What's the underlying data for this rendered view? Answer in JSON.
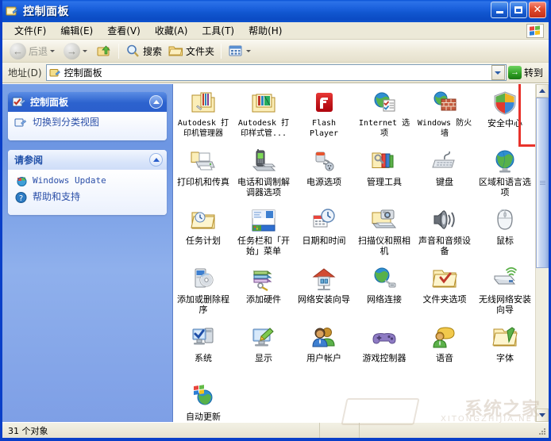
{
  "window": {
    "title": "控制面板",
    "title_icon": "control-panel-icon",
    "buttons": {
      "minimize": "–",
      "maximize": "□",
      "close": "✕"
    }
  },
  "menubar": {
    "items": [
      {
        "label": "文件(F)",
        "name": "menu-file"
      },
      {
        "label": "编辑(E)",
        "name": "menu-edit"
      },
      {
        "label": "查看(V)",
        "name": "menu-view"
      },
      {
        "label": "收藏(A)",
        "name": "menu-favorites"
      },
      {
        "label": "工具(T)",
        "name": "menu-tools"
      },
      {
        "label": "帮助(H)",
        "name": "menu-help"
      }
    ],
    "brand_icon": "windows-flag-icon"
  },
  "toolbar": {
    "back_label": "后退",
    "forward_label": "",
    "up_label": "",
    "search_label": "搜索",
    "folders_label": "文件夹",
    "views_label": ""
  },
  "addressbar": {
    "label": "地址(D)",
    "value": "控制面板",
    "go_label": "转到",
    "go_arrow": "→"
  },
  "sidebar": {
    "panels": [
      {
        "title": "控制面板",
        "icon": "control-panel-icon",
        "collapse_icon": "chevron-up-icon",
        "links": [
          {
            "label": "切换到分类视图",
            "icon": "switch-view-icon",
            "mono": false
          }
        ]
      },
      {
        "title": "请参阅",
        "icon": "",
        "collapse_icon": "chevron-up-icon",
        "links": [
          {
            "label": "Windows Update",
            "icon": "windows-update-icon",
            "mono": true
          },
          {
            "label": "帮助和支持",
            "icon": "help-support-icon",
            "mono": false
          }
        ]
      }
    ]
  },
  "content": {
    "highlighted_item": "Internet 选项",
    "highlight_color": "#E8322B",
    "items": [
      {
        "label": "Autodesk 打印机管理器",
        "icon": "autodesk-plotter-manager-icon",
        "mono": true
      },
      {
        "label": "Autodesk 打印样式管...",
        "icon": "autodesk-plot-style-icon",
        "mono": true
      },
      {
        "label": "Flash Player",
        "icon": "flash-player-icon",
        "mono": true
      },
      {
        "label": "Internet 选项",
        "icon": "internet-options-icon",
        "mono": true
      },
      {
        "label": "Windows 防火墙",
        "icon": "windows-firewall-icon",
        "mono": true
      },
      {
        "label": "安全中心",
        "icon": "security-center-icon",
        "mono": false
      },
      {
        "label": "打印机和传真",
        "icon": "printers-and-faxes-icon",
        "mono": false
      },
      {
        "label": "电话和调制解调器选项",
        "icon": "phone-and-modem-icon",
        "mono": false
      },
      {
        "label": "电源选项",
        "icon": "power-options-icon",
        "mono": false
      },
      {
        "label": "管理工具",
        "icon": "administrative-tools-icon",
        "mono": false
      },
      {
        "label": "键盘",
        "icon": "keyboard-icon",
        "mono": false
      },
      {
        "label": "区域和语言选项",
        "icon": "regional-language-icon",
        "mono": false
      },
      {
        "label": "任务计划",
        "icon": "scheduled-tasks-icon",
        "mono": false
      },
      {
        "label": "任务栏和「开始」菜单",
        "icon": "taskbar-start-menu-icon",
        "mono": false
      },
      {
        "label": "日期和时间",
        "icon": "date-and-time-icon",
        "mono": false
      },
      {
        "label": "扫描仪和照相机",
        "icon": "scanners-and-cameras-icon",
        "mono": false
      },
      {
        "label": "声音和音频设备",
        "icon": "sounds-audio-devices-icon",
        "mono": false
      },
      {
        "label": "鼠标",
        "icon": "mouse-icon",
        "mono": false
      },
      {
        "label": "添加或删除程序",
        "icon": "add-remove-programs-icon",
        "mono": false
      },
      {
        "label": "添加硬件",
        "icon": "add-hardware-icon",
        "mono": false
      },
      {
        "label": "网络安装向导",
        "icon": "network-setup-wizard-icon",
        "mono": false
      },
      {
        "label": "网络连接",
        "icon": "network-connections-icon",
        "mono": false
      },
      {
        "label": "文件夹选项",
        "icon": "folder-options-icon",
        "mono": false
      },
      {
        "label": "无线网络安装向导",
        "icon": "wireless-network-wizard-icon",
        "mono": false
      },
      {
        "label": "系统",
        "icon": "system-icon",
        "mono": false
      },
      {
        "label": "显示",
        "icon": "display-icon",
        "mono": false
      },
      {
        "label": "用户帐户",
        "icon": "user-accounts-icon",
        "mono": false
      },
      {
        "label": "游戏控制器",
        "icon": "game-controllers-icon",
        "mono": false
      },
      {
        "label": "语音",
        "icon": "speech-icon",
        "mono": false
      },
      {
        "label": "字体",
        "icon": "fonts-icon",
        "mono": false
      },
      {
        "label": "自动更新",
        "icon": "automatic-updates-icon",
        "mono": false
      }
    ]
  },
  "statusbar": {
    "object_count": "31 个对象"
  },
  "watermark": {
    "text": "系统之家",
    "subtext": "XITONGZHIJIA.NET"
  }
}
